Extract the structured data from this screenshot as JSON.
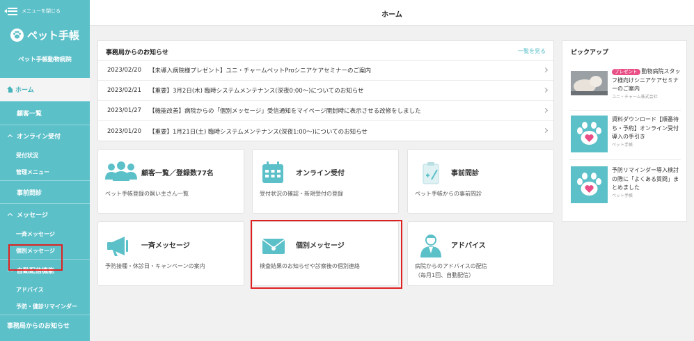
{
  "sidebar": {
    "close_label": "メニューを閉じる",
    "brand": "ペット手帳",
    "clinic": "ペット手帳動物病院",
    "items": [
      {
        "label": "ホーム"
      },
      {
        "label": "顧客一覧"
      },
      {
        "label": "オンライン受付"
      },
      {
        "label": "受付状況"
      },
      {
        "label": "管理メニュー"
      },
      {
        "label": "事前問診"
      },
      {
        "label": "メッセージ"
      },
      {
        "label": "一斉メッセージ"
      },
      {
        "label": "個別メッセージ"
      },
      {
        "label": "自動配信機能"
      },
      {
        "label": "アドバイス"
      },
      {
        "label": "予防・健診リマインダー"
      },
      {
        "label": "事務局からのお知らせ"
      }
    ]
  },
  "header": {
    "title": "ホーム"
  },
  "notices": {
    "title": "事務局からのお知らせ",
    "more": "一覧を見る",
    "rows": [
      {
        "date": "2023/02/20",
        "text": "【未導入病院様プレゼント】ユニ・チャームペットProシニアケアセミナーのご案内"
      },
      {
        "date": "2023/02/21",
        "text": "【重要】3月2日(木) 臨時システムメンテナンス(深夜0:00〜)についてのお知らせ"
      },
      {
        "date": "2023/01/27",
        "text": "【機能改善】病院からの「個別メッセージ」受信通知をマイページ開封時に表示させる改修をしました"
      },
      {
        "date": "2023/01/20",
        "text": "【重要】1月21日(土) 臨時システムメンテナンス(深夜1:00〜)についてのお知らせ"
      }
    ]
  },
  "cards": [
    {
      "title": "顧客一覧／登録数77名",
      "desc": "ペット手帳登録の飼い主さん一覧",
      "icon": "people-icon"
    },
    {
      "title": "オンライン受付",
      "desc": "受付状況の確認・新規受付の登録",
      "icon": "calendar-icon"
    },
    {
      "title": "事前問診",
      "desc": "ペット手帳からの事前問診",
      "icon": "clipboard-icon"
    },
    {
      "title": "一斉メッセージ",
      "desc": "予防接種・休診日・キャンペーンの案内",
      "icon": "megaphone-icon"
    },
    {
      "title": "個別メッセージ",
      "desc": "検査結果のお知らせや診察後の個別連絡",
      "icon": "envelope-icon"
    },
    {
      "title": "アドバイス",
      "desc": "病院からのアドバイスの配信",
      "desc2": "（毎月1回、自動配信）",
      "icon": "doctor-icon"
    }
  ],
  "pickup": {
    "title": "ピックアップ",
    "items": [
      {
        "badge": "プレゼント",
        "text": "動物病院スタッフ様向けシニアケアセミナーのご案内",
        "source": "ユニ・チャーム株式会社"
      },
      {
        "text": "資料ダウンロード【順番待ち・予約】オンライン受付導入の手引き",
        "source": "ペット手帳"
      },
      {
        "text": "予防リマインダー導入検討の際に「よくある質問」まとめました",
        "source": "ペット手帳"
      }
    ]
  },
  "colors": {
    "accent": "#5cc0c9",
    "highlight": "#e02020",
    "badge": "#e94f86"
  }
}
